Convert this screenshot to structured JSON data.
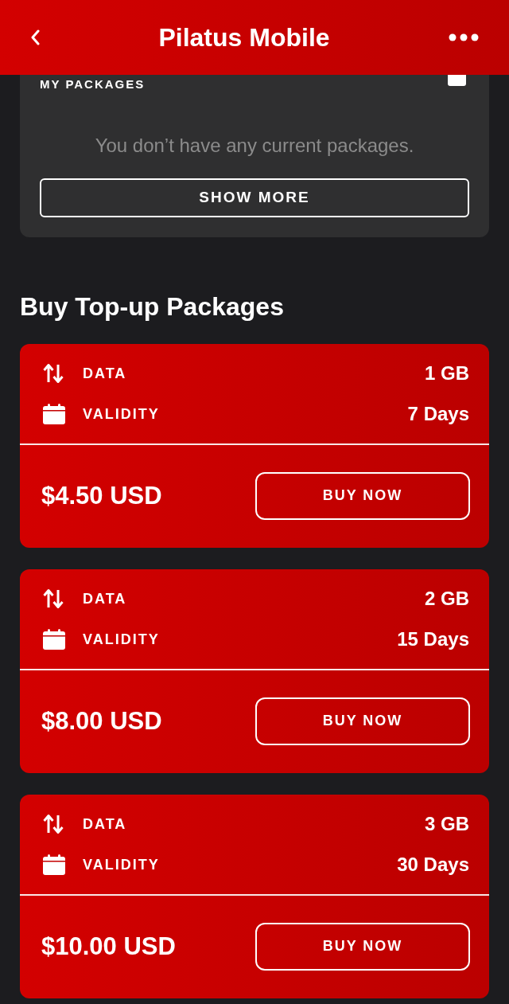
{
  "header": {
    "title": "Pilatus Mobile"
  },
  "my_packages": {
    "title": "MY PACKAGES",
    "empty_message": "You don’t have any current packages.",
    "button": "SHOW MORE"
  },
  "section_title": "Buy Top-up Packages",
  "packages": [
    {
      "rows": [
        {
          "kind": "data",
          "label": "DATA",
          "value": "1 GB"
        },
        {
          "kind": "validity",
          "label": "VALIDITY",
          "value": "7 Days"
        }
      ],
      "price": "$4.50 USD",
      "button": "BUY NOW"
    },
    {
      "rows": [
        {
          "kind": "data",
          "label": "DATA",
          "value": "2 GB"
        },
        {
          "kind": "validity",
          "label": "VALIDITY",
          "value": "15 Days"
        }
      ],
      "price": "$8.00 USD",
      "button": "BUY NOW"
    },
    {
      "rows": [
        {
          "kind": "data",
          "label": "DATA",
          "value": "3 GB"
        },
        {
          "kind": "validity",
          "label": "VALIDITY",
          "value": "30 Days"
        }
      ],
      "price": "$10.00 USD",
      "button": "BUY NOW"
    }
  ]
}
